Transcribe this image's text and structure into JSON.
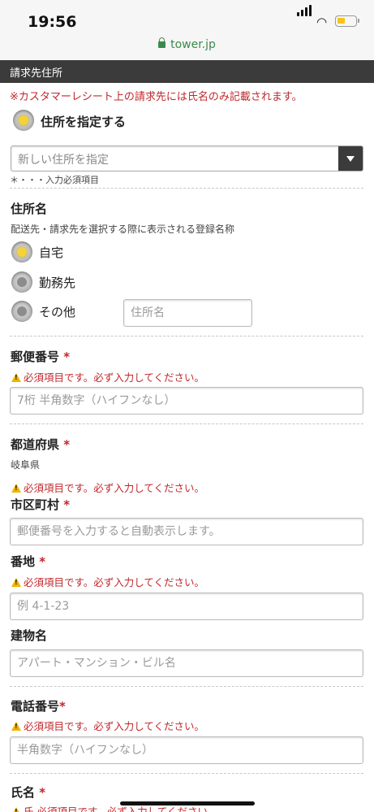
{
  "status_bar": {
    "time": "19:56",
    "url": "tower.jp"
  },
  "header": {
    "title": "請求先住所"
  },
  "notice": "※カスタマーレシート上の請求先には氏名のみ記載されます。",
  "address_mode": {
    "label": "住所を指定する",
    "select_value": "新しい住所を指定",
    "required_note": "＊・・・入力必須項目"
  },
  "address_name": {
    "label": "住所名",
    "help": "配送先・請求先を選択する際に表示される登録名称",
    "options": [
      "自宅",
      "勤務先",
      "その他"
    ],
    "selected": "自宅",
    "other_placeholder": "住所名"
  },
  "postal": {
    "label": "郵便番号",
    "req": "*",
    "error": "必須項目です。必ず入力してください。",
    "placeholder": "7桁 半角数字（ハイフンなし）"
  },
  "prefecture": {
    "label": "都道府県",
    "req": "*",
    "value": "岐阜県",
    "error": "必須項目です。必ず入力してください。"
  },
  "city": {
    "label": "市区町村",
    "req": "*",
    "placeholder": "郵便番号を入力すると自動表示します。"
  },
  "street": {
    "label": "番地",
    "req": "*",
    "error": "必須項目です。必ず入力してください。",
    "placeholder": "例 4-1-23"
  },
  "building": {
    "label": "建物名",
    "placeholder": "アパート・マンション・ビル名"
  },
  "phone": {
    "label": "電話番号",
    "req": "*",
    "error": "必須項目です。必ず入力してください。",
    "placeholder": "半角数字（ハイフンなし）"
  },
  "name": {
    "label": "氏名",
    "req": "*",
    "error": "氏 必須項目です。必ず入力してください。"
  }
}
